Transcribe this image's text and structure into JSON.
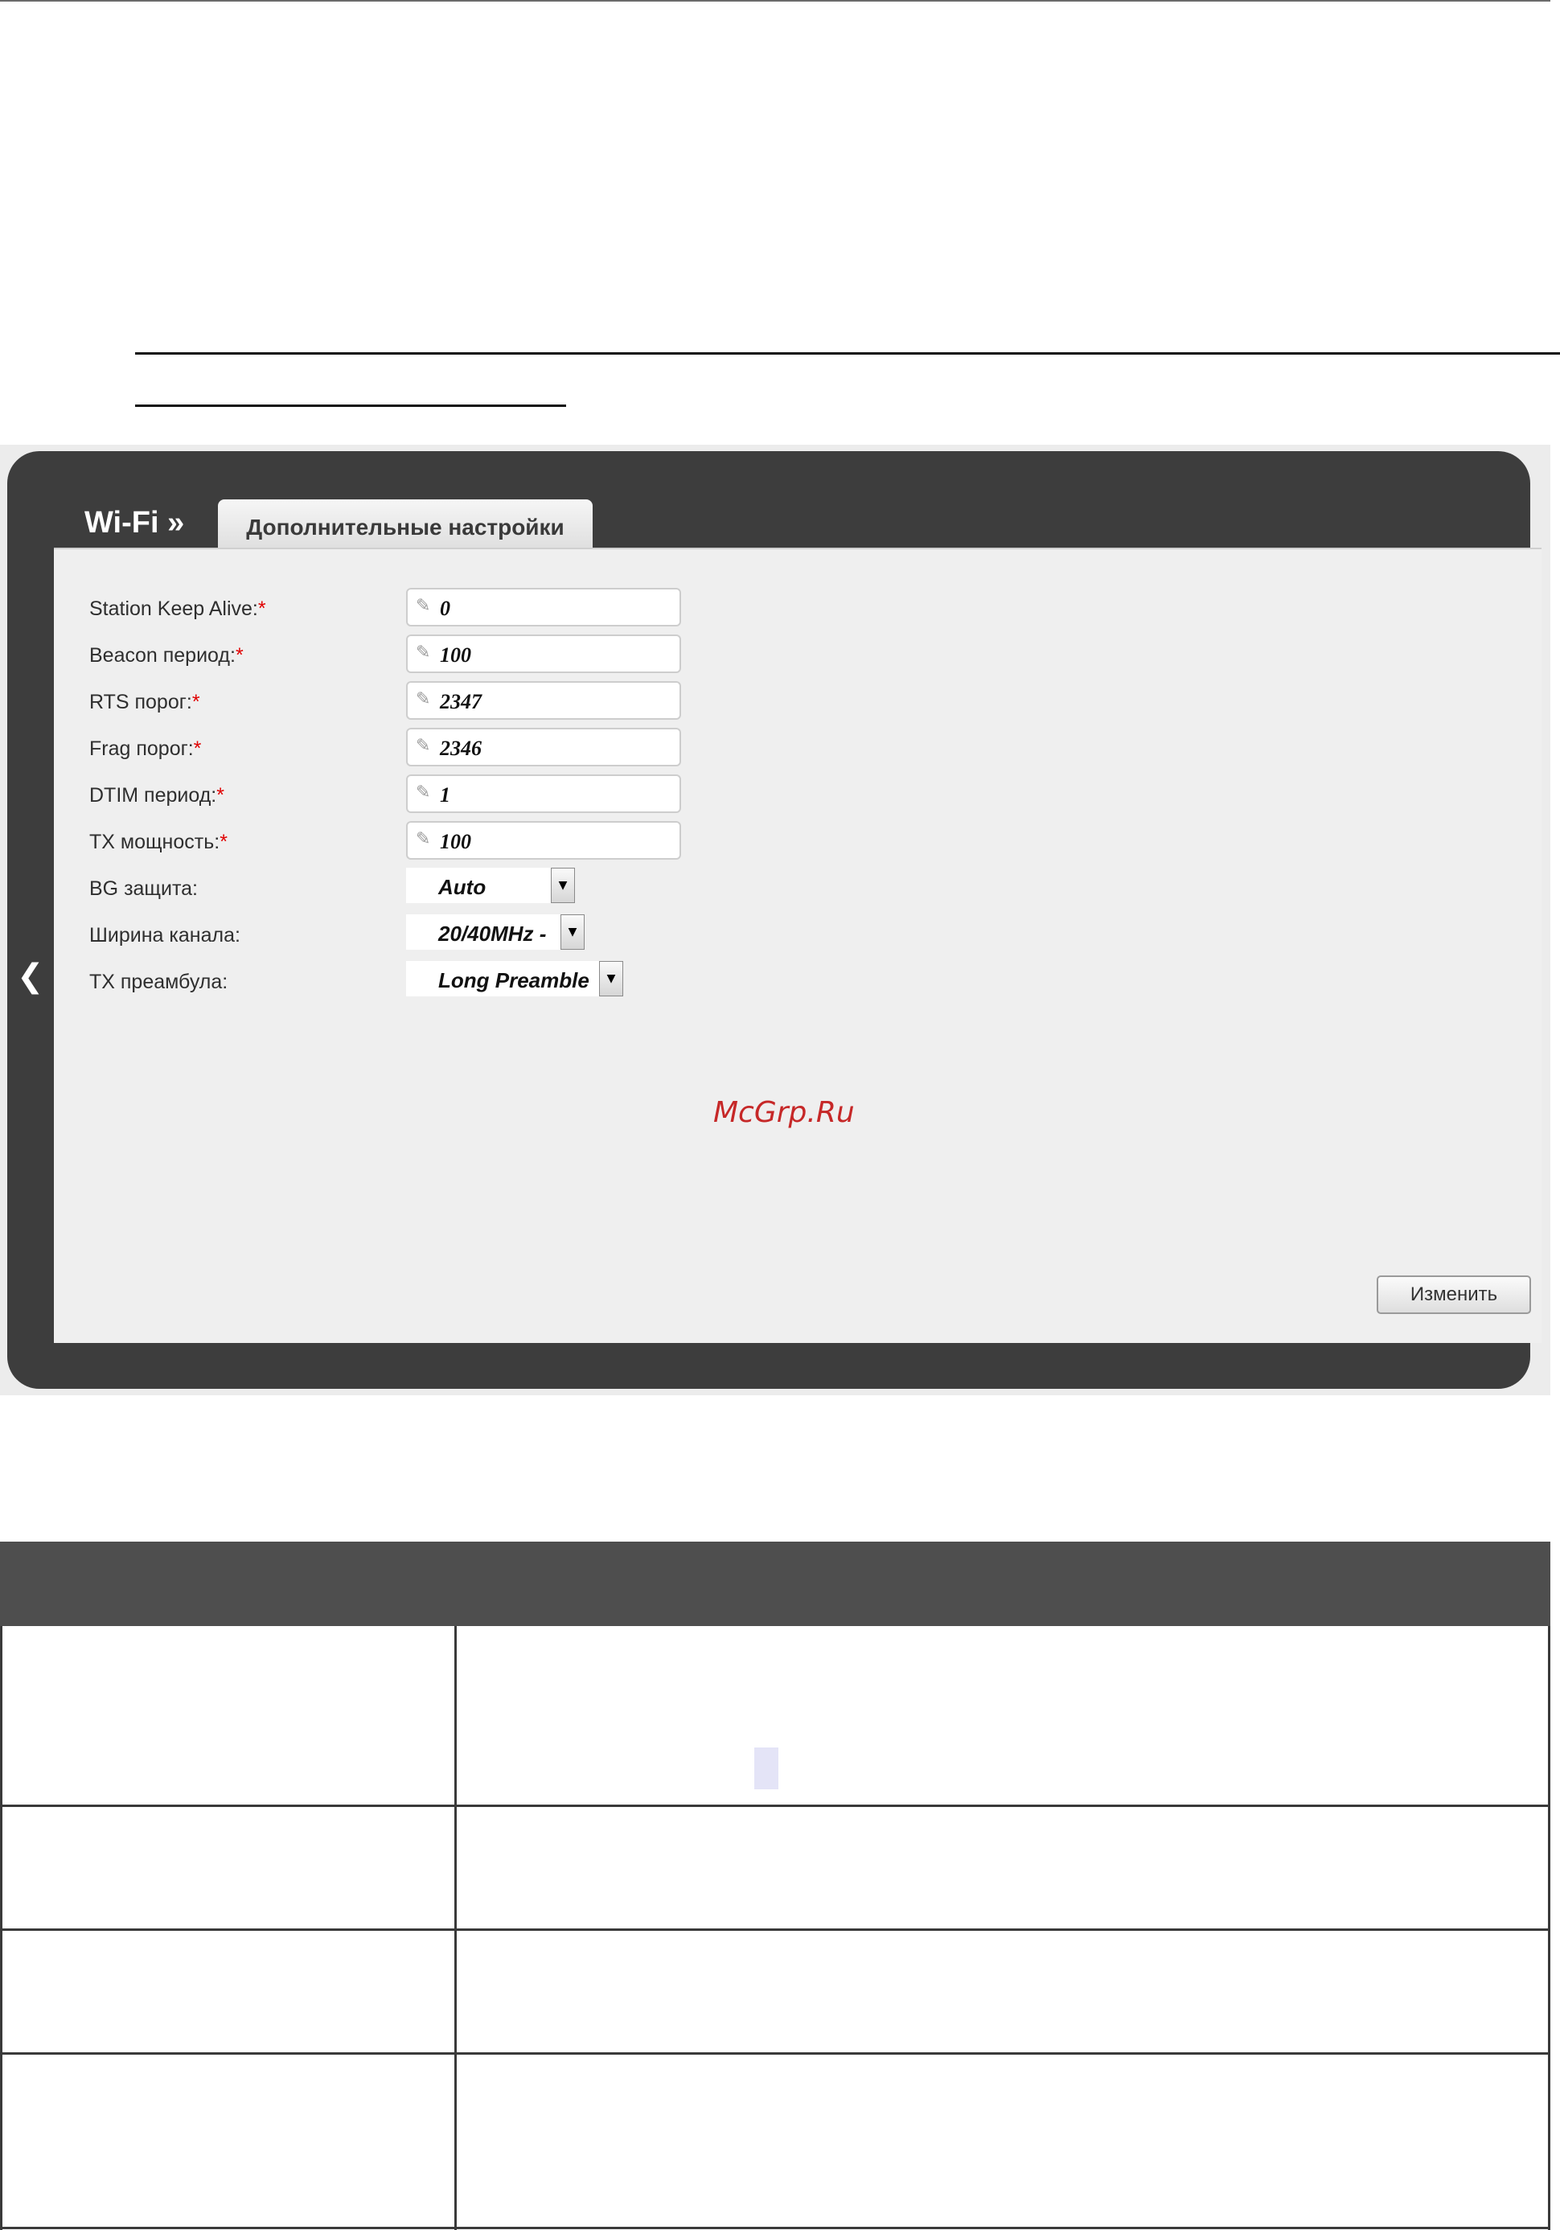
{
  "screenshot": {
    "brand": "Wi-Fi »",
    "tab_label": "Дополнительные настройки",
    "fields": [
      {
        "label": "Station Keep Alive:",
        "required": "*",
        "value": "0"
      },
      {
        "label": "Beacon период:",
        "required": "*",
        "value": "100"
      },
      {
        "label": "RTS порог:",
        "required": "*",
        "value": "2347"
      },
      {
        "label": "Frag порог:",
        "required": "*",
        "value": "2346"
      },
      {
        "label": "DTIM период:",
        "required": "*",
        "value": "1"
      },
      {
        "label": "TX мощность:",
        "required": "*",
        "value": "100"
      }
    ],
    "selects": [
      {
        "label": "BG защита:",
        "value": "Auto"
      },
      {
        "label": "Ширина канала:",
        "value": "20/40MHz -"
      },
      {
        "label": "TX преамбула:",
        "value": "Long Preamble"
      }
    ],
    "watermark": "McGrp.Ru",
    "apply_button": "Изменить"
  }
}
